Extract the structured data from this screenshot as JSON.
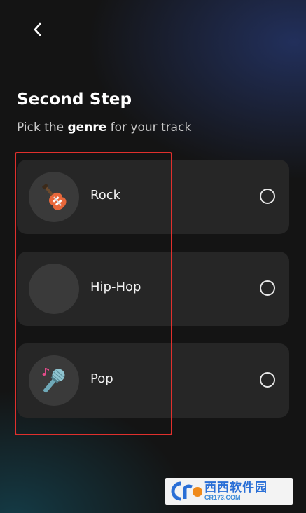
{
  "header": {
    "back_icon": "chevron-left-icon"
  },
  "step": {
    "title": "Second Step",
    "subtitle_pre": "Pick the ",
    "subtitle_bold": "genre",
    "subtitle_post": " for your track"
  },
  "genres": [
    {
      "label": "Rock",
      "icon": "electric-guitar-icon",
      "selected": false
    },
    {
      "label": "Hip-Hop",
      "icon": "",
      "selected": false
    },
    {
      "label": "Pop",
      "icon": "microphone-icon",
      "selected": false
    }
  ],
  "colors": {
    "highlight": "#e0302d",
    "card": "#262626",
    "background": "#141414"
  },
  "watermark": {
    "main": "西西软件园",
    "sub": "CR173.COM"
  }
}
